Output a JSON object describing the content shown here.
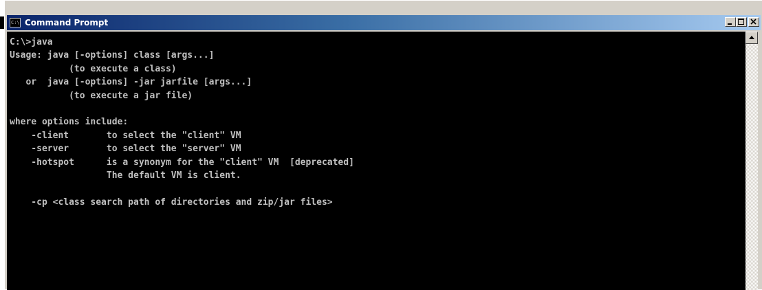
{
  "window": {
    "title": "Command Prompt",
    "icon": "command-prompt-icon",
    "icon_text": "C:\\"
  },
  "title_buttons": {
    "minimize": "minimize-icon",
    "maximize": "maximize-icon",
    "close": "close-icon"
  },
  "console": {
    "lines": [
      "C:\\>java",
      "Usage: java [-options] class [args...]",
      "           (to execute a class)",
      "   or  java [-options] -jar jarfile [args...]",
      "           (to execute a jar file)",
      "",
      "where options include:",
      "    -client       to select the \"client\" VM",
      "    -server       to select the \"server\" VM",
      "    -hotspot      is a synonym for the \"client\" VM  [deprecated]",
      "                  The default VM is client.",
      "",
      "    -cp <class search path of directories and zip/jar files>"
    ]
  },
  "colors": {
    "console_background": "#000000",
    "console_text": "#c0c0c0",
    "titlebar_start": "#0a246a",
    "titlebar_end": "#a6caf0",
    "window_frame": "#d4d0c8"
  }
}
